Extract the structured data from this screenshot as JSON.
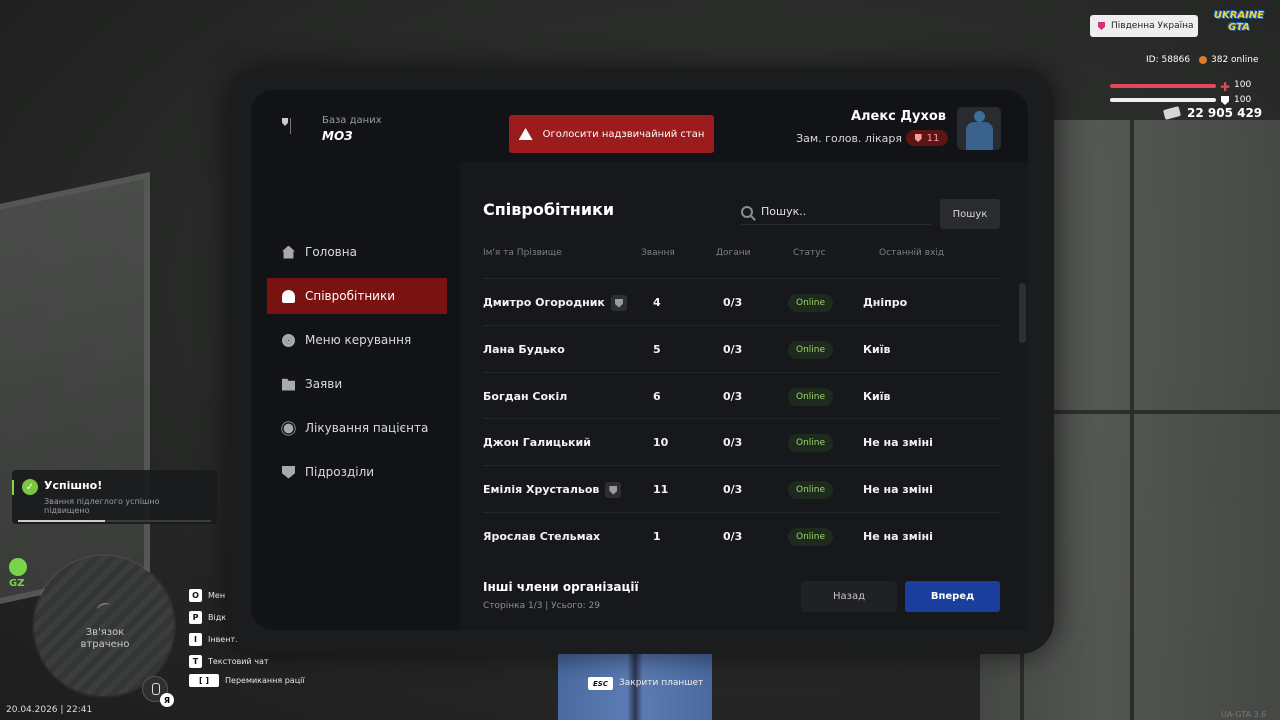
{
  "hud": {
    "server": "Південна Україна",
    "logo_line1": "UKRAINE",
    "logo_line2": "GTA",
    "id": "ID: 58866",
    "online": "382 online",
    "health": "100",
    "armor": "100",
    "money": "22 905 429",
    "hp_symbol": "✚"
  },
  "header": {
    "brand_subtitle": "База даних",
    "brand_title": "МОЗ",
    "emergency_button": "Оголосити надзвичайний стан",
    "user_name": "Алекс Духов",
    "user_role": "Зам. голов. лікаря",
    "user_badge_count": "11"
  },
  "sidebar": {
    "items": [
      {
        "label": "Головна",
        "icon": "home-icon"
      },
      {
        "label": "Співробітники",
        "icon": "users-icon",
        "active": true
      },
      {
        "label": "Меню керування",
        "icon": "gear-icon"
      },
      {
        "label": "Заяви",
        "icon": "folder-icon"
      },
      {
        "label": "Лікування пацієнта",
        "icon": "sun-icon"
      },
      {
        "label": "Підрозділи",
        "icon": "shield-icon"
      }
    ]
  },
  "main": {
    "title": "Співробітники",
    "search_placeholder": "Пошук..",
    "search_button": "Пошук",
    "columns": {
      "name": "Ім'я та Прізвище",
      "rank": "Звання",
      "warnings": "Догани",
      "status": "Статус",
      "last_login": "Останній вхід"
    },
    "rows": [
      {
        "name": "Дмитро Огородник",
        "rank": "4",
        "warnings": "0/3",
        "status": "Online",
        "last_login": "Дніпро",
        "shield": true
      },
      {
        "name": "Лана Будько",
        "rank": "5",
        "warnings": "0/3",
        "status": "Online",
        "last_login": "Київ",
        "shield": false
      },
      {
        "name": "Богдан Сокіл",
        "rank": "6",
        "warnings": "0/3",
        "status": "Online",
        "last_login": "Київ",
        "shield": false
      },
      {
        "name": "Джон Галицький",
        "rank": "10",
        "warnings": "0/3",
        "status": "Online",
        "last_login": "Не на зміні",
        "shield": false
      },
      {
        "name": "Емілія Хрустальов",
        "rank": "11",
        "warnings": "0/3",
        "status": "Online",
        "last_login": "Не на зміні",
        "shield": true
      },
      {
        "name": "Ярослав Стельмах",
        "rank": "1",
        "warnings": "0/3",
        "status": "Online",
        "last_login": "Не на зміні",
        "shield": false
      }
    ],
    "footer_title": "Інші члени організації",
    "footer_sub": "Сторінка 1/3 | Усього: 29",
    "back_button": "Назад",
    "next_button": "Вперед"
  },
  "toast": {
    "title": "Успішно!",
    "message": "Звання підлеглого успішно підвищено",
    "progress": 0.45
  },
  "minimap": {
    "zone": "GZ",
    "status": "Зв'язок втрачено",
    "lang": "Я"
  },
  "keybinds": [
    {
      "key": "O",
      "label": "Мен"
    },
    {
      "key": "P",
      "label": "Відк"
    },
    {
      "key": "I",
      "label": "Інвент."
    },
    {
      "key": "T",
      "label": "Текстовий чат"
    },
    {
      "key": "[ ]",
      "label": "Перемикання рації"
    }
  ],
  "footer": {
    "datetime": "20.04.2026 | 22:41",
    "esc_key": "ESC",
    "esc_label": "Закрити планшет",
    "version": "UA-GTA 3.6"
  },
  "colors": {
    "accent_red": "#9b1c1c",
    "active_nav": "#7b1212",
    "next_button": "#1b3d9b",
    "online_green": "#9bd36a"
  }
}
